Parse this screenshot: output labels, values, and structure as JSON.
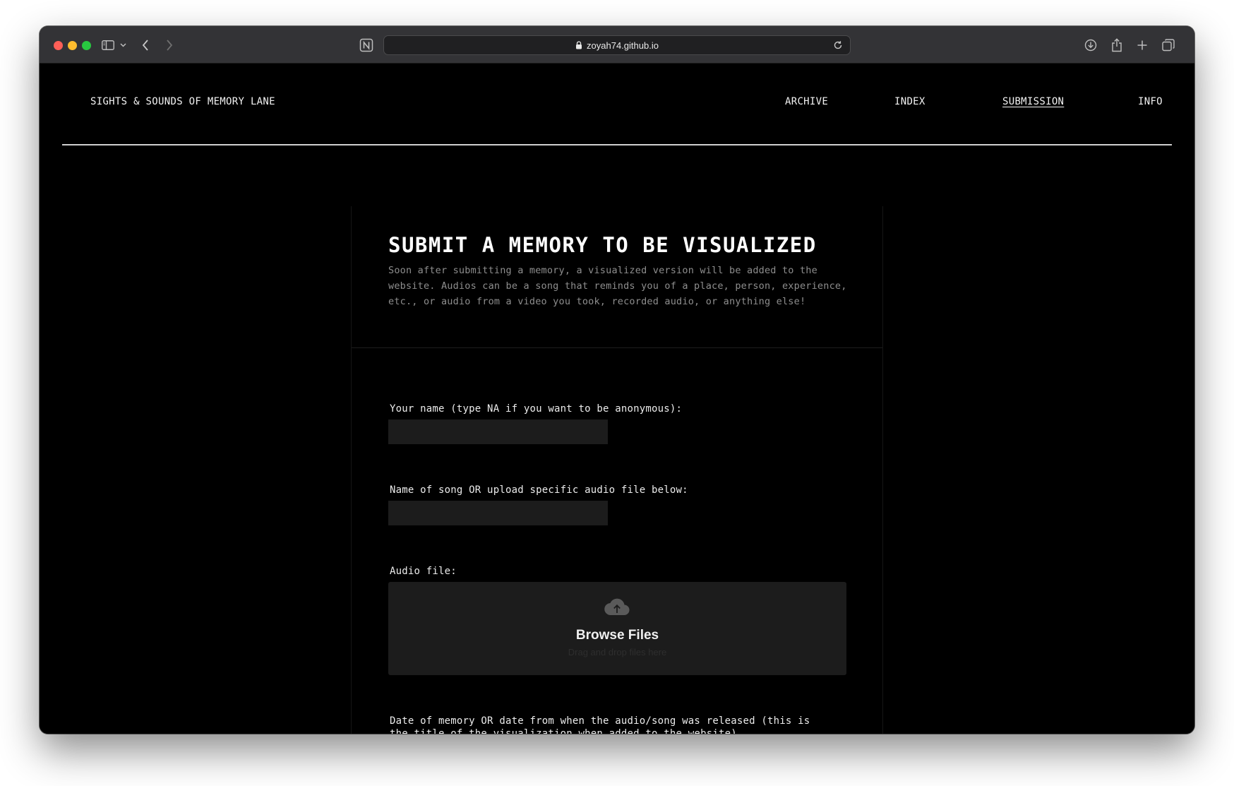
{
  "browser": {
    "url": "zoyah74.github.io"
  },
  "nav": {
    "brand": "SIGHTS & SOUNDS OF MEMORY LANE",
    "links": [
      {
        "label": "ARCHIVE"
      },
      {
        "label": "INDEX"
      },
      {
        "label": "SUBMISSION",
        "active": true
      },
      {
        "label": "INFO"
      }
    ]
  },
  "form": {
    "title": "SUBMIT A MEMORY TO BE VISUALIZED",
    "description": "Soon after submitting a memory, a visualized version will be added to the website. Audios can be a song that reminds you of a place, person, experience, etc., or audio from a video you took, recorded audio, or anything else!",
    "fields": [
      {
        "label": "Your name (type NA if you want to be anonymous):",
        "value": ""
      },
      {
        "label": "Name of song OR upload specific audio file below:",
        "value": ""
      },
      {
        "label": "Audio file:"
      },
      {
        "label": "Date of memory OR date from when the audio/song was released (this is the title of the visualization when added to the website)",
        "value": ""
      }
    ],
    "dropzone": {
      "title": "Browse Files",
      "subtitle": "Drag and drop files here",
      "icon": "cloud-upload-icon"
    }
  },
  "colors": {
    "background": "#000000",
    "input_bg": "#1c1c1c",
    "description_text": "#8e8e8e",
    "titlebar": "#333336"
  }
}
